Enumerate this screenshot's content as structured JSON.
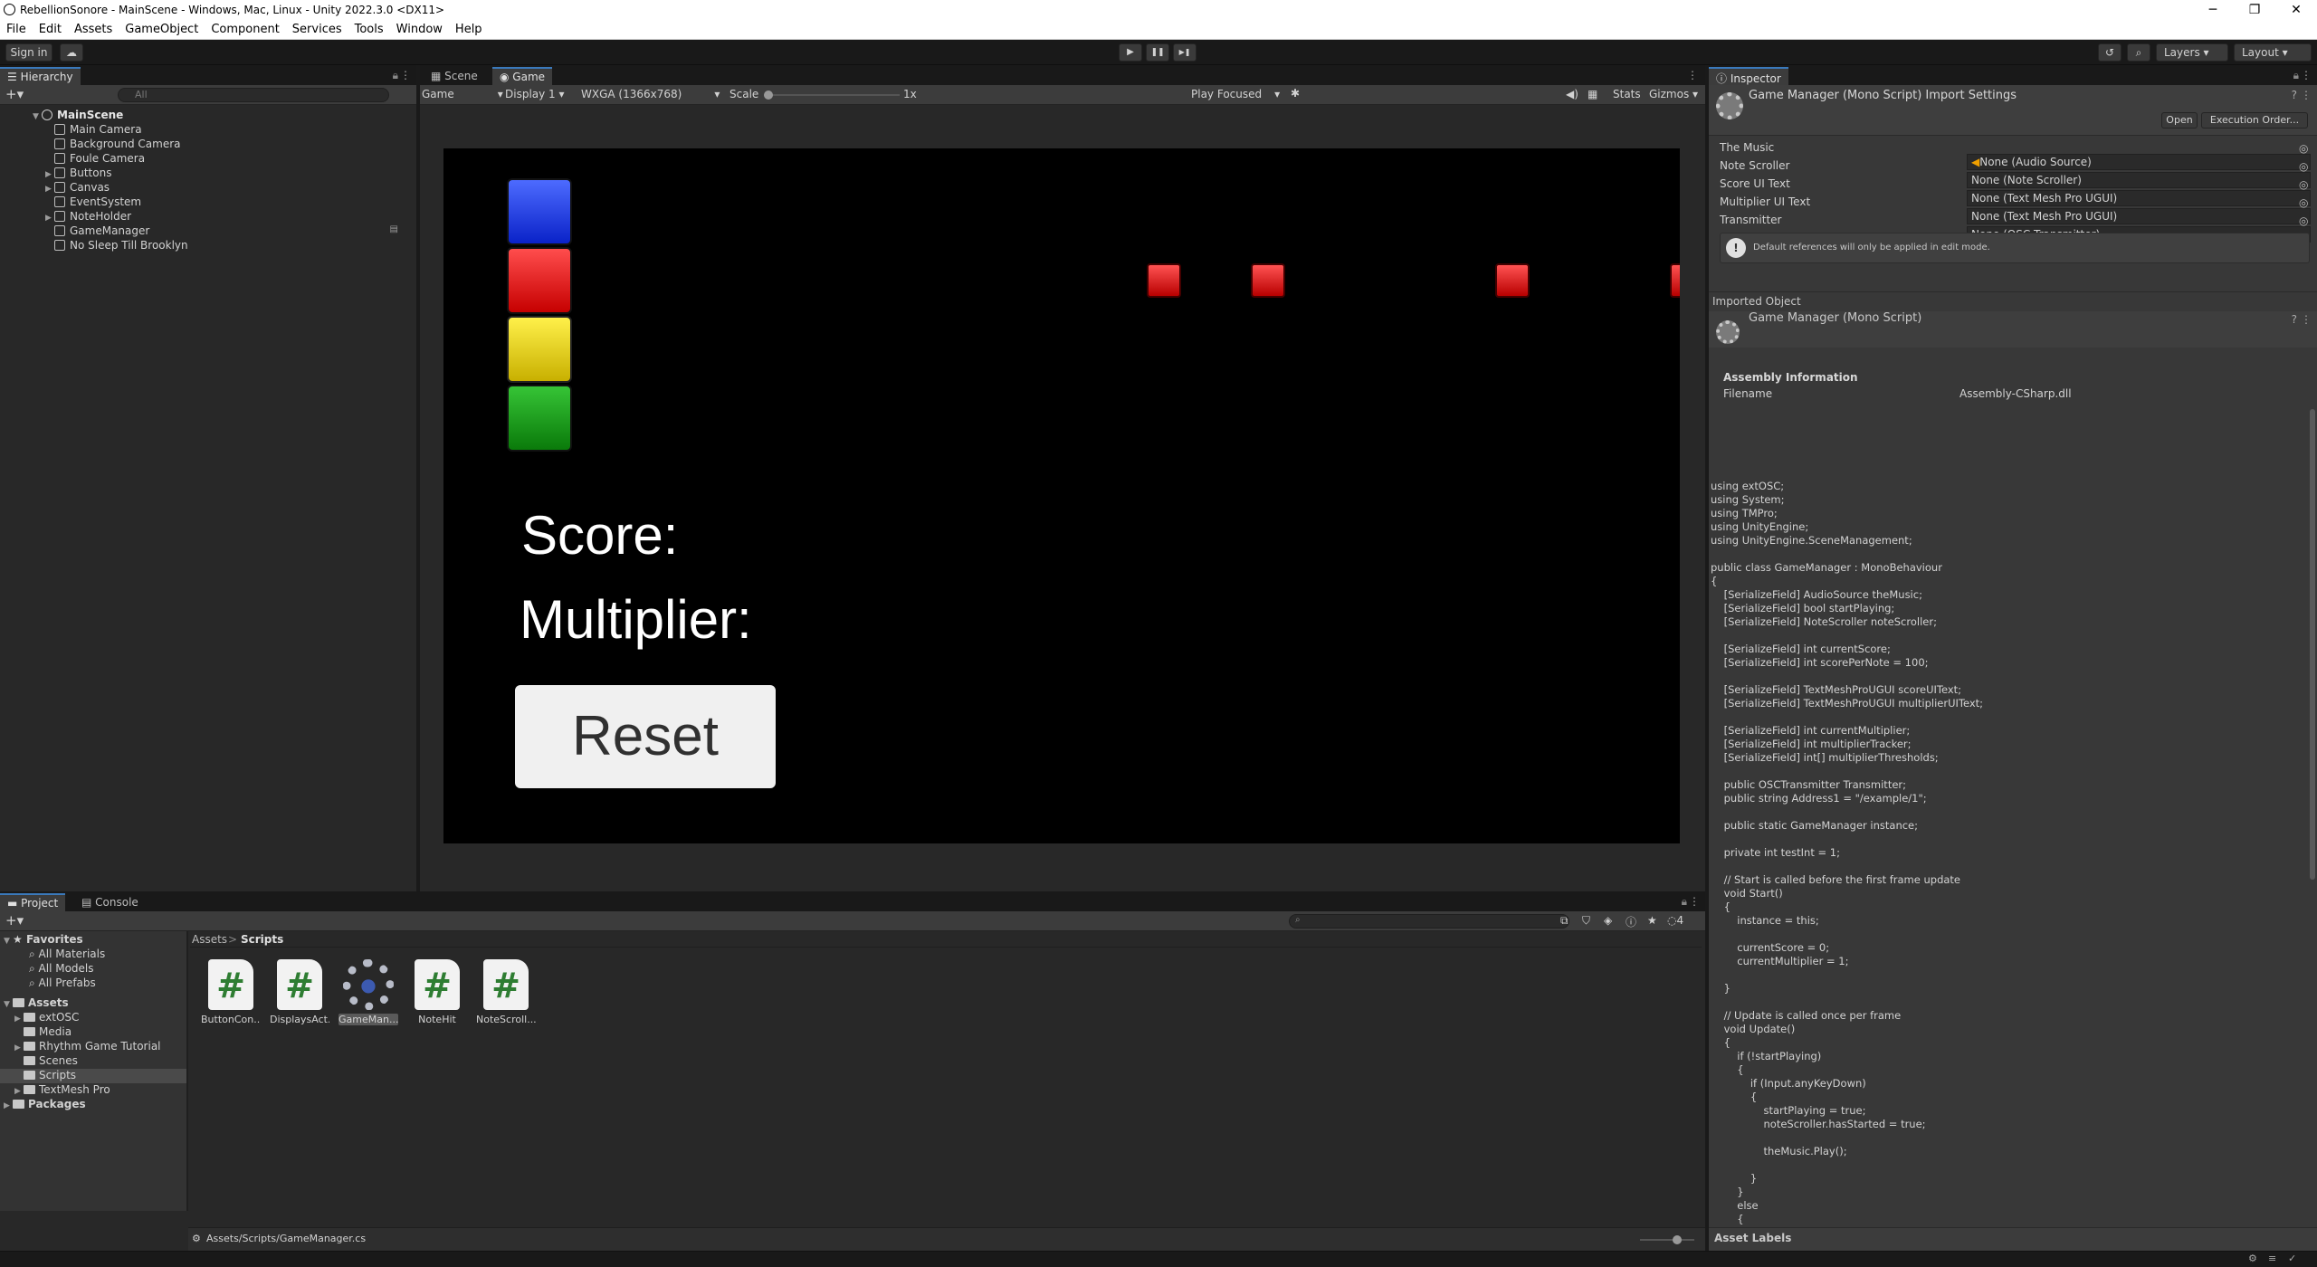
{
  "window": {
    "title": "RebellionSonore - MainScene - Windows, Mac, Linux - Unity 2022.3.0 <DX11>",
    "controls": [
      "─",
      "❐",
      "✕"
    ]
  },
  "menu": [
    "File",
    "Edit",
    "Assets",
    "GameObject",
    "Component",
    "Services",
    "Tools",
    "Window",
    "Help"
  ],
  "toolbar": {
    "sign_in": "Sign in",
    "layers": "Layers",
    "layout": "Layout",
    "play": "▶",
    "pause": "❚❚",
    "step": "▶❚"
  },
  "hierarchy": {
    "tab": "Hierarchy",
    "search_placeholder": "All",
    "scene": "MainScene",
    "items": [
      "Main Camera",
      "Background Camera",
      "Foule Camera",
      "Buttons",
      "Canvas",
      "EventSystem",
      "NoteHolder",
      "GameManager",
      "No Sleep Till Brooklyn"
    ]
  },
  "sceneview": {
    "tabs": [
      "Scene",
      "Game"
    ],
    "game_dropdown": "Game",
    "display": "Display 1",
    "resolution": "WXGA (1366x768)",
    "scale_label": "Scale",
    "scale_value": "1x",
    "play_mode": "Play Focused",
    "stats": "Stats",
    "gizmos": "Gizmos"
  },
  "game": {
    "score_label": "Score:",
    "multiplier_label": "Multiplier:",
    "reset_label": "Reset",
    "colors": {
      "blue": "#1d3fff",
      "red": "#ff1a1a",
      "yellow": "#f5e000",
      "green": "#1a9a1a",
      "note": "#ff2a2a"
    }
  },
  "inspector": {
    "tab": "Inspector",
    "header_title": "Game Manager (Mono Script) Import Settings",
    "open_btn": "Open",
    "exec_btn": "Execution Order...",
    "props": [
      {
        "label": "The Music",
        "value": "None (Audio Source)"
      },
      {
        "label": "Note Scroller",
        "value": "None (Note Scroller)"
      },
      {
        "label": "Score UI Text",
        "value": "None (Text Mesh Pro UGUI)"
      },
      {
        "label": "Multiplier UI Text",
        "value": "None (Text Mesh Pro UGUI)"
      },
      {
        "label": "Transmitter",
        "value": "None (OSC Transmitter)"
      }
    ],
    "help_text": "Default references will only be applied in edit mode.",
    "imported_object": "Imported Object",
    "imported_title": "Game Manager (Mono Script)",
    "assembly_info": "Assembly Information",
    "filename_label": "Filename",
    "filename_value": "Assembly-CSharp.dll",
    "code": "using extOSC;\nusing System;\nusing TMPro;\nusing UnityEngine;\nusing UnityEngine.SceneManagement;\n\npublic class GameManager : MonoBehaviour\n{\n    [SerializeField] AudioSource theMusic;\n    [SerializeField] bool startPlaying;\n    [SerializeField] NoteScroller noteScroller;\n\n    [SerializeField] int currentScore;\n    [SerializeField] int scorePerNote = 100;\n\n    [SerializeField] TextMeshProUGUI scoreUIText;\n    [SerializeField] TextMeshProUGUI multiplierUIText;\n\n    [SerializeField] int currentMultiplier;\n    [SerializeField] int multiplierTracker;\n    [SerializeField] int[] multiplierThresholds;\n\n    public OSCTransmitter Transmitter;\n    public string Address1 = \"/example/1\";\n\n    public static GameManager instance;\n\n    private int testInt = 1;\n\n    // Start is called before the first frame update\n    void Start()\n    {\n        instance = this;\n\n        currentScore = 0;\n        currentMultiplier = 1;\n\n    }\n\n    // Update is called once per frame\n    void Update()\n    {\n        if (!startPlaying)\n        {\n            if (Input.anyKeyDown)\n            {\n                startPlaying = true;\n                noteScroller.hasStarted = true;\n\n                theMusic.Play();\n\n            }\n        }\n        else\n        {\n\n        }\n        // debug ff\n        theMusic.pitch = Time.timeScale;\n    }",
    "asset_labels": "Asset Labels"
  },
  "project": {
    "tabs": [
      "Project",
      "Console"
    ],
    "favorites": "Favorites",
    "favorite_items": [
      "All Materials",
      "All Models",
      "All Prefabs"
    ],
    "assets": "Assets",
    "asset_folders": [
      "extOSC",
      "Media",
      "Rhythm Game Tutorial",
      "Scenes",
      "Scripts",
      "TextMesh Pro"
    ],
    "packages": "Packages",
    "breadcrumb": [
      "Assets",
      "Scripts"
    ],
    "breadcrumb_sep": ">",
    "files": [
      "ButtonCon...",
      "DisplaysAct...",
      "GameMan...",
      "NoteHit",
      "NoteScroll..."
    ],
    "hidden_count": "4",
    "status_path": "Assets/Scripts/GameManager.cs"
  }
}
